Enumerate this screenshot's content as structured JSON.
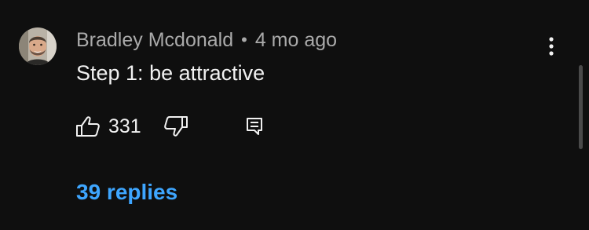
{
  "comment": {
    "author": "Bradley Mcdonald",
    "separator": "•",
    "timestamp": "4 mo ago",
    "text": "Step 1: be attractive",
    "likes": "331",
    "replies_label": "39 replies"
  },
  "icons": {
    "avatar": "avatar-photo",
    "more": "vertical-ellipsis-icon",
    "like": "thumbs-up-icon",
    "dislike": "thumbs-down-icon",
    "reply": "reply-comment-icon"
  },
  "colors": {
    "background": "#0f0f0f",
    "link": "#3ea6ff",
    "secondary_text": "#aaaaaa",
    "primary_text": "#f1f1f1"
  }
}
